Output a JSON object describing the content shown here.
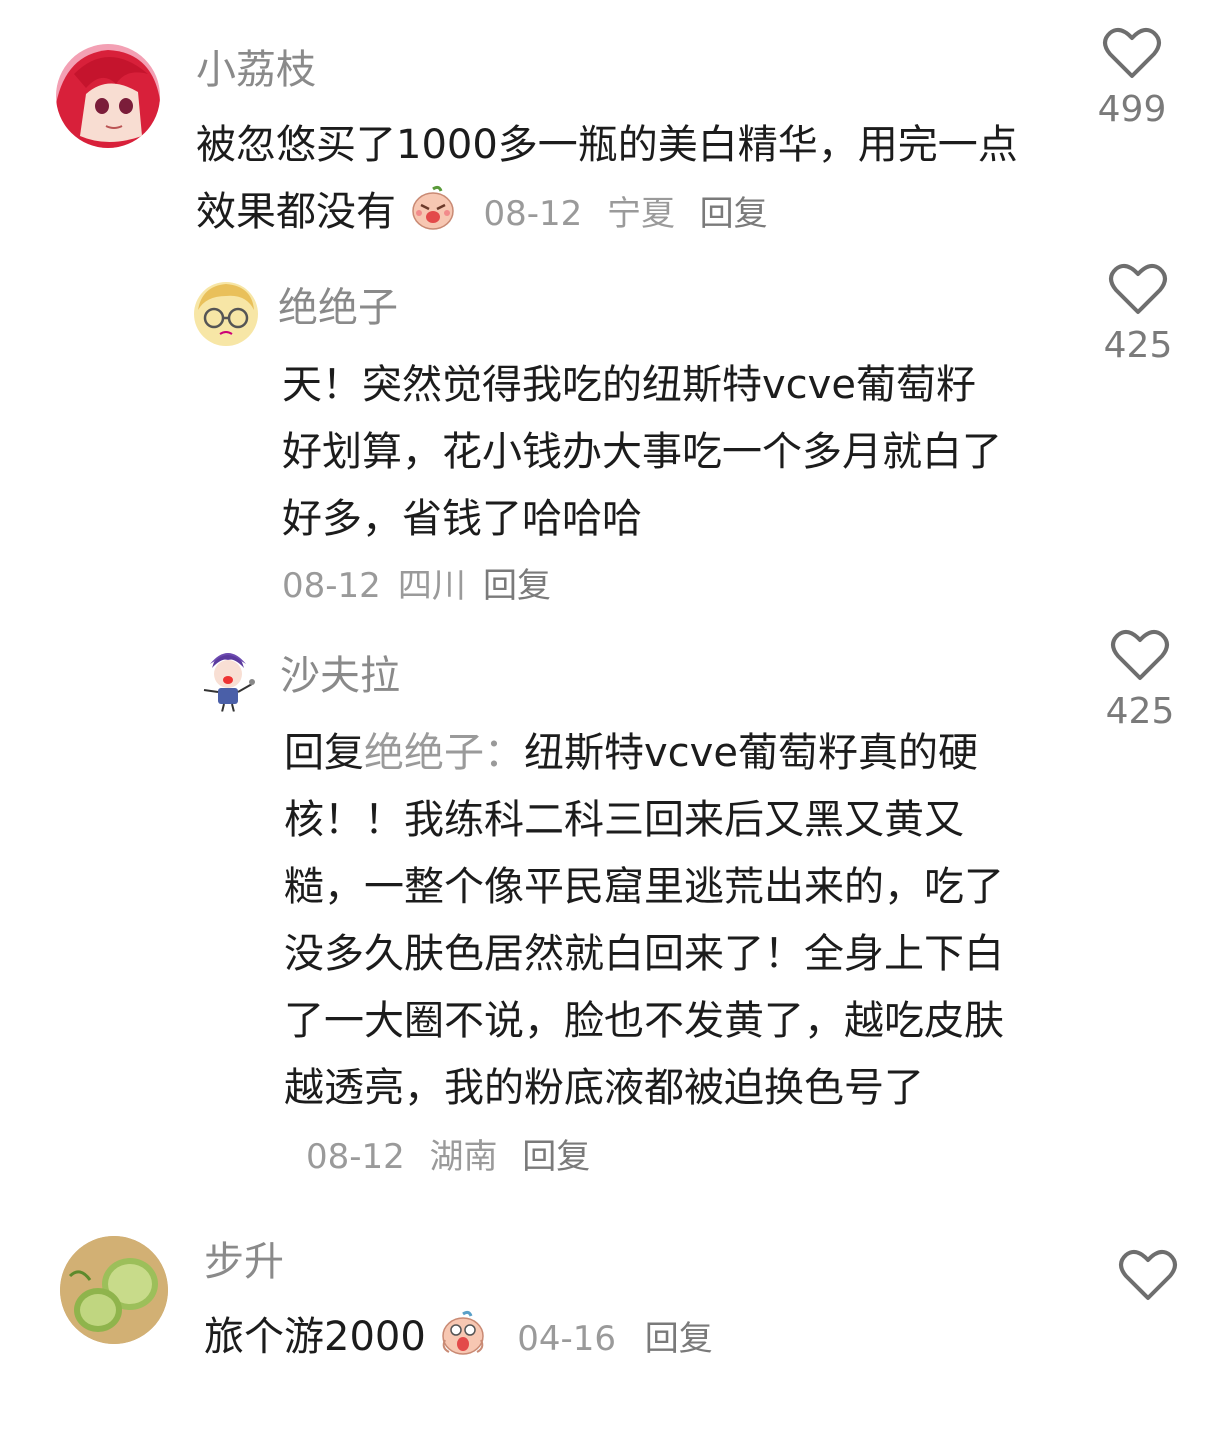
{
  "comments": [
    {
      "username": "小荔枝",
      "text": "被忽悠买了1000多一瓶的美白精华，用完一点效果都没有",
      "emoji": "crying-emoji",
      "date": "08-12",
      "location": "宁夏",
      "reply_label": "回复",
      "likes": "499"
    },
    {
      "username": "绝绝子",
      "text": "天！突然觉得我吃的纽斯特vcve葡萄籽好划算，花小钱办大事吃一个多月就白了好多，省钱了哈哈哈",
      "date": "08-12",
      "location": "四川",
      "reply_label": "回复",
      "likes": "425"
    },
    {
      "username": "沙夫拉",
      "reply_prefix": "回复",
      "reply_to": "绝绝子：",
      "text": "纽斯特vcve葡萄籽真的硬核！！我练科二科三回来后又黑又黄又糙，一整个像平民窟里逃荒出来的，吃了没多久肤色居然就白回来了！全身上下白了一大圈不说，脸也不发黄了，越吃皮肤越透亮，我的粉底液都被迫换色号了",
      "date": "08-12",
      "location": "湖南",
      "reply_label": "回复",
      "likes": "425"
    },
    {
      "username": "步升",
      "text": "旅个游2000",
      "emoji": "scream-emoji",
      "date": "04-16",
      "reply_label": "回复"
    }
  ],
  "colors": {
    "username": "#8a8a8a",
    "meta": "#9a9a9a",
    "text": "#1c1c1c",
    "heart_stroke": "#6e6e6e"
  }
}
